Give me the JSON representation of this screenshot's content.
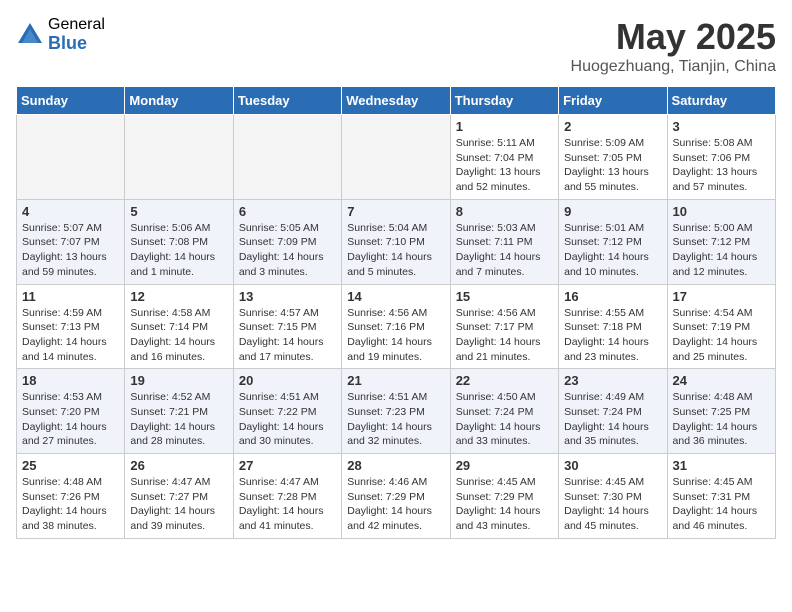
{
  "header": {
    "logo_general": "General",
    "logo_blue": "Blue",
    "month_year": "May 2025",
    "location": "Huogezhuang, Tianjin, China"
  },
  "weekdays": [
    "Sunday",
    "Monday",
    "Tuesday",
    "Wednesday",
    "Thursday",
    "Friday",
    "Saturday"
  ],
  "weeks": [
    [
      {
        "day": "",
        "info": ""
      },
      {
        "day": "",
        "info": ""
      },
      {
        "day": "",
        "info": ""
      },
      {
        "day": "",
        "info": ""
      },
      {
        "day": "1",
        "info": "Sunrise: 5:11 AM\nSunset: 7:04 PM\nDaylight: 13 hours\nand 52 minutes."
      },
      {
        "day": "2",
        "info": "Sunrise: 5:09 AM\nSunset: 7:05 PM\nDaylight: 13 hours\nand 55 minutes."
      },
      {
        "day": "3",
        "info": "Sunrise: 5:08 AM\nSunset: 7:06 PM\nDaylight: 13 hours\nand 57 minutes."
      }
    ],
    [
      {
        "day": "4",
        "info": "Sunrise: 5:07 AM\nSunset: 7:07 PM\nDaylight: 13 hours\nand 59 minutes."
      },
      {
        "day": "5",
        "info": "Sunrise: 5:06 AM\nSunset: 7:08 PM\nDaylight: 14 hours\nand 1 minute."
      },
      {
        "day": "6",
        "info": "Sunrise: 5:05 AM\nSunset: 7:09 PM\nDaylight: 14 hours\nand 3 minutes."
      },
      {
        "day": "7",
        "info": "Sunrise: 5:04 AM\nSunset: 7:10 PM\nDaylight: 14 hours\nand 5 minutes."
      },
      {
        "day": "8",
        "info": "Sunrise: 5:03 AM\nSunset: 7:11 PM\nDaylight: 14 hours\nand 7 minutes."
      },
      {
        "day": "9",
        "info": "Sunrise: 5:01 AM\nSunset: 7:12 PM\nDaylight: 14 hours\nand 10 minutes."
      },
      {
        "day": "10",
        "info": "Sunrise: 5:00 AM\nSunset: 7:12 PM\nDaylight: 14 hours\nand 12 minutes."
      }
    ],
    [
      {
        "day": "11",
        "info": "Sunrise: 4:59 AM\nSunset: 7:13 PM\nDaylight: 14 hours\nand 14 minutes."
      },
      {
        "day": "12",
        "info": "Sunrise: 4:58 AM\nSunset: 7:14 PM\nDaylight: 14 hours\nand 16 minutes."
      },
      {
        "day": "13",
        "info": "Sunrise: 4:57 AM\nSunset: 7:15 PM\nDaylight: 14 hours\nand 17 minutes."
      },
      {
        "day": "14",
        "info": "Sunrise: 4:56 AM\nSunset: 7:16 PM\nDaylight: 14 hours\nand 19 minutes."
      },
      {
        "day": "15",
        "info": "Sunrise: 4:56 AM\nSunset: 7:17 PM\nDaylight: 14 hours\nand 21 minutes."
      },
      {
        "day": "16",
        "info": "Sunrise: 4:55 AM\nSunset: 7:18 PM\nDaylight: 14 hours\nand 23 minutes."
      },
      {
        "day": "17",
        "info": "Sunrise: 4:54 AM\nSunset: 7:19 PM\nDaylight: 14 hours\nand 25 minutes."
      }
    ],
    [
      {
        "day": "18",
        "info": "Sunrise: 4:53 AM\nSunset: 7:20 PM\nDaylight: 14 hours\nand 27 minutes."
      },
      {
        "day": "19",
        "info": "Sunrise: 4:52 AM\nSunset: 7:21 PM\nDaylight: 14 hours\nand 28 minutes."
      },
      {
        "day": "20",
        "info": "Sunrise: 4:51 AM\nSunset: 7:22 PM\nDaylight: 14 hours\nand 30 minutes."
      },
      {
        "day": "21",
        "info": "Sunrise: 4:51 AM\nSunset: 7:23 PM\nDaylight: 14 hours\nand 32 minutes."
      },
      {
        "day": "22",
        "info": "Sunrise: 4:50 AM\nSunset: 7:24 PM\nDaylight: 14 hours\nand 33 minutes."
      },
      {
        "day": "23",
        "info": "Sunrise: 4:49 AM\nSunset: 7:24 PM\nDaylight: 14 hours\nand 35 minutes."
      },
      {
        "day": "24",
        "info": "Sunrise: 4:48 AM\nSunset: 7:25 PM\nDaylight: 14 hours\nand 36 minutes."
      }
    ],
    [
      {
        "day": "25",
        "info": "Sunrise: 4:48 AM\nSunset: 7:26 PM\nDaylight: 14 hours\nand 38 minutes."
      },
      {
        "day": "26",
        "info": "Sunrise: 4:47 AM\nSunset: 7:27 PM\nDaylight: 14 hours\nand 39 minutes."
      },
      {
        "day": "27",
        "info": "Sunrise: 4:47 AM\nSunset: 7:28 PM\nDaylight: 14 hours\nand 41 minutes."
      },
      {
        "day": "28",
        "info": "Sunrise: 4:46 AM\nSunset: 7:29 PM\nDaylight: 14 hours\nand 42 minutes."
      },
      {
        "day": "29",
        "info": "Sunrise: 4:45 AM\nSunset: 7:29 PM\nDaylight: 14 hours\nand 43 minutes."
      },
      {
        "day": "30",
        "info": "Sunrise: 4:45 AM\nSunset: 7:30 PM\nDaylight: 14 hours\nand 45 minutes."
      },
      {
        "day": "31",
        "info": "Sunrise: 4:45 AM\nSunset: 7:31 PM\nDaylight: 14 hours\nand 46 minutes."
      }
    ]
  ]
}
